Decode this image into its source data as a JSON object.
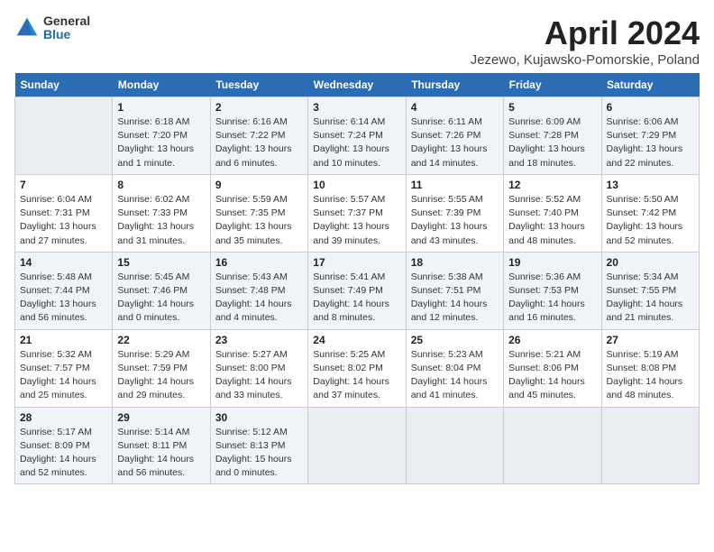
{
  "header": {
    "logo_general": "General",
    "logo_blue": "Blue",
    "month_title": "April 2024",
    "location": "Jezewo, Kujawsko-Pomorskie, Poland"
  },
  "weekdays": [
    "Sunday",
    "Monday",
    "Tuesday",
    "Wednesday",
    "Thursday",
    "Friday",
    "Saturday"
  ],
  "weeks": [
    [
      {
        "num": "",
        "detail": ""
      },
      {
        "num": "1",
        "detail": "Sunrise: 6:18 AM\nSunset: 7:20 PM\nDaylight: 13 hours\nand 1 minute."
      },
      {
        "num": "2",
        "detail": "Sunrise: 6:16 AM\nSunset: 7:22 PM\nDaylight: 13 hours\nand 6 minutes."
      },
      {
        "num": "3",
        "detail": "Sunrise: 6:14 AM\nSunset: 7:24 PM\nDaylight: 13 hours\nand 10 minutes."
      },
      {
        "num": "4",
        "detail": "Sunrise: 6:11 AM\nSunset: 7:26 PM\nDaylight: 13 hours\nand 14 minutes."
      },
      {
        "num": "5",
        "detail": "Sunrise: 6:09 AM\nSunset: 7:28 PM\nDaylight: 13 hours\nand 18 minutes."
      },
      {
        "num": "6",
        "detail": "Sunrise: 6:06 AM\nSunset: 7:29 PM\nDaylight: 13 hours\nand 22 minutes."
      }
    ],
    [
      {
        "num": "7",
        "detail": "Sunrise: 6:04 AM\nSunset: 7:31 PM\nDaylight: 13 hours\nand 27 minutes."
      },
      {
        "num": "8",
        "detail": "Sunrise: 6:02 AM\nSunset: 7:33 PM\nDaylight: 13 hours\nand 31 minutes."
      },
      {
        "num": "9",
        "detail": "Sunrise: 5:59 AM\nSunset: 7:35 PM\nDaylight: 13 hours\nand 35 minutes."
      },
      {
        "num": "10",
        "detail": "Sunrise: 5:57 AM\nSunset: 7:37 PM\nDaylight: 13 hours\nand 39 minutes."
      },
      {
        "num": "11",
        "detail": "Sunrise: 5:55 AM\nSunset: 7:39 PM\nDaylight: 13 hours\nand 43 minutes."
      },
      {
        "num": "12",
        "detail": "Sunrise: 5:52 AM\nSunset: 7:40 PM\nDaylight: 13 hours\nand 48 minutes."
      },
      {
        "num": "13",
        "detail": "Sunrise: 5:50 AM\nSunset: 7:42 PM\nDaylight: 13 hours\nand 52 minutes."
      }
    ],
    [
      {
        "num": "14",
        "detail": "Sunrise: 5:48 AM\nSunset: 7:44 PM\nDaylight: 13 hours\nand 56 minutes."
      },
      {
        "num": "15",
        "detail": "Sunrise: 5:45 AM\nSunset: 7:46 PM\nDaylight: 14 hours\nand 0 minutes."
      },
      {
        "num": "16",
        "detail": "Sunrise: 5:43 AM\nSunset: 7:48 PM\nDaylight: 14 hours\nand 4 minutes."
      },
      {
        "num": "17",
        "detail": "Sunrise: 5:41 AM\nSunset: 7:49 PM\nDaylight: 14 hours\nand 8 minutes."
      },
      {
        "num": "18",
        "detail": "Sunrise: 5:38 AM\nSunset: 7:51 PM\nDaylight: 14 hours\nand 12 minutes."
      },
      {
        "num": "19",
        "detail": "Sunrise: 5:36 AM\nSunset: 7:53 PM\nDaylight: 14 hours\nand 16 minutes."
      },
      {
        "num": "20",
        "detail": "Sunrise: 5:34 AM\nSunset: 7:55 PM\nDaylight: 14 hours\nand 21 minutes."
      }
    ],
    [
      {
        "num": "21",
        "detail": "Sunrise: 5:32 AM\nSunset: 7:57 PM\nDaylight: 14 hours\nand 25 minutes."
      },
      {
        "num": "22",
        "detail": "Sunrise: 5:29 AM\nSunset: 7:59 PM\nDaylight: 14 hours\nand 29 minutes."
      },
      {
        "num": "23",
        "detail": "Sunrise: 5:27 AM\nSunset: 8:00 PM\nDaylight: 14 hours\nand 33 minutes."
      },
      {
        "num": "24",
        "detail": "Sunrise: 5:25 AM\nSunset: 8:02 PM\nDaylight: 14 hours\nand 37 minutes."
      },
      {
        "num": "25",
        "detail": "Sunrise: 5:23 AM\nSunset: 8:04 PM\nDaylight: 14 hours\nand 41 minutes."
      },
      {
        "num": "26",
        "detail": "Sunrise: 5:21 AM\nSunset: 8:06 PM\nDaylight: 14 hours\nand 45 minutes."
      },
      {
        "num": "27",
        "detail": "Sunrise: 5:19 AM\nSunset: 8:08 PM\nDaylight: 14 hours\nand 48 minutes."
      }
    ],
    [
      {
        "num": "28",
        "detail": "Sunrise: 5:17 AM\nSunset: 8:09 PM\nDaylight: 14 hours\nand 52 minutes."
      },
      {
        "num": "29",
        "detail": "Sunrise: 5:14 AM\nSunset: 8:11 PM\nDaylight: 14 hours\nand 56 minutes."
      },
      {
        "num": "30",
        "detail": "Sunrise: 5:12 AM\nSunset: 8:13 PM\nDaylight: 15 hours\nand 0 minutes."
      },
      {
        "num": "",
        "detail": ""
      },
      {
        "num": "",
        "detail": ""
      },
      {
        "num": "",
        "detail": ""
      },
      {
        "num": "",
        "detail": ""
      }
    ]
  ]
}
